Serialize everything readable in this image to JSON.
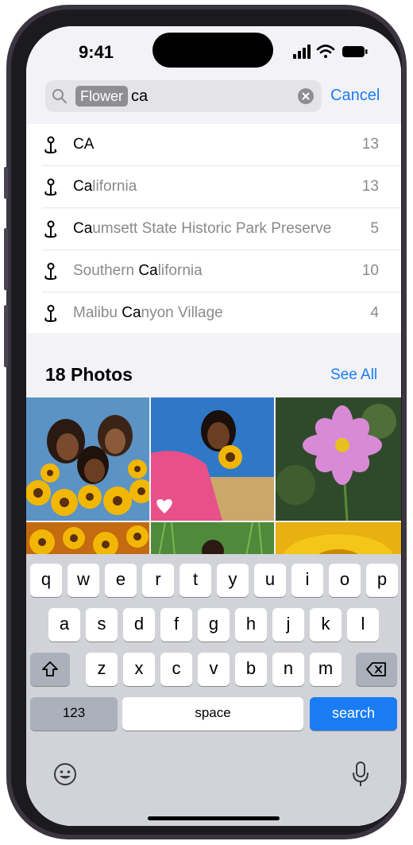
{
  "status_bar": {
    "time": "9:41"
  },
  "search": {
    "token": "Flower",
    "query": "ca",
    "cancel_label": "Cancel"
  },
  "results": [
    {
      "match": "CA",
      "rest": "",
      "prefix": "",
      "count": "13"
    },
    {
      "match": "Ca",
      "rest": "lifornia",
      "prefix": "",
      "count": "13"
    },
    {
      "match": "Ca",
      "rest": "umsett State Historic Park Preserve",
      "prefix": "",
      "count": "5"
    },
    {
      "prefix": "Southern ",
      "match": "Ca",
      "rest": "lifornia",
      "count": "10"
    },
    {
      "prefix": "Malibu ",
      "match": "Ca",
      "rest": "nyon Village",
      "count": "4"
    }
  ],
  "photos": {
    "title": "18 Photos",
    "see_all_label": "See All"
  },
  "keyboard": {
    "row1": [
      "q",
      "w",
      "e",
      "r",
      "t",
      "y",
      "u",
      "i",
      "o",
      "p"
    ],
    "row2": [
      "a",
      "s",
      "d",
      "f",
      "g",
      "h",
      "j",
      "k",
      "l"
    ],
    "row3": [
      "z",
      "x",
      "c",
      "v",
      "b",
      "n",
      "m"
    ],
    "numbers_label": "123",
    "space_label": "space",
    "search_label": "search"
  },
  "colors": {
    "accent": "#1a7cf5",
    "keyboard_bg": "#d1d3d9"
  }
}
